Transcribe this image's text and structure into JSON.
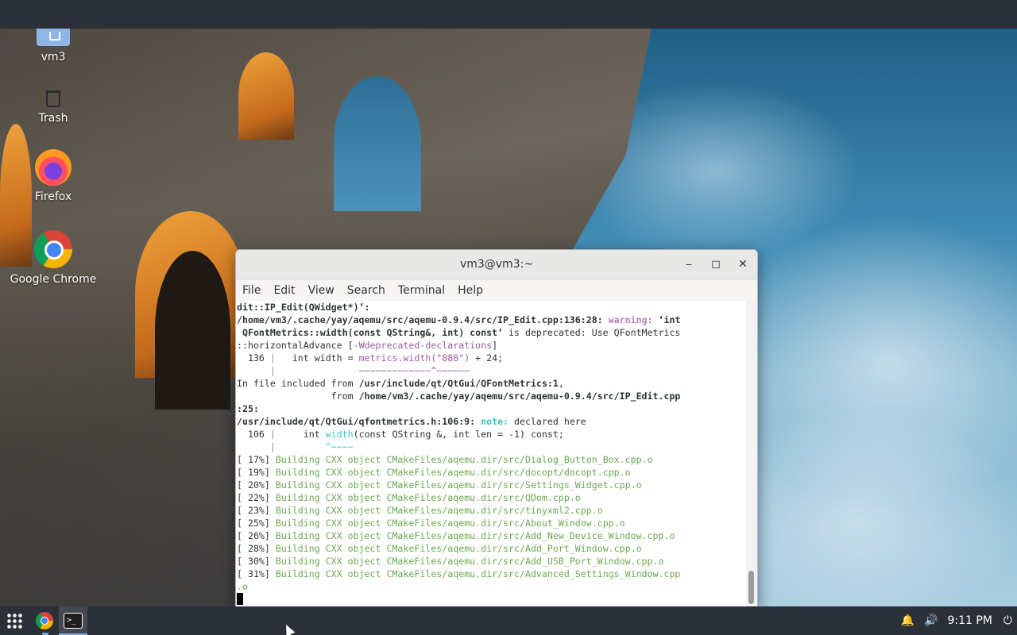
{
  "desktop": {
    "icons": [
      {
        "label": "vm3",
        "icon": "home-folder-icon"
      },
      {
        "label": "Trash",
        "icon": "trash-icon"
      },
      {
        "label": "Firefox",
        "icon": "firefox-icon"
      },
      {
        "label": "Google Chrome",
        "icon": "chrome-icon"
      }
    ]
  },
  "terminal": {
    "title": "vm3@vm3:~",
    "window_controls": {
      "minimize": "⎯",
      "maximize": "◻",
      "close": "✕"
    },
    "menu": [
      "File",
      "Edit",
      "View",
      "Search",
      "Terminal",
      "Help"
    ],
    "lines": {
      "l1": "dit::IP_Edit(QWidget*)’:",
      "l2a": "/home/vm3/.cache/yay/aqemu/src/aqemu-0.9.4/src/IP_Edit.cpp:136:28: ",
      "l2b": "warning: ",
      "l2c": "‘int",
      "l3a": " QFontMetrics::width(const QString&, int) const’",
      "l3b": " is deprecated: Use QFontMetrics",
      "l4a": "::horizontalAdvance [",
      "l4b": "-Wdeprecated-declarations",
      "l4c": "]",
      "l5a": "  136 ",
      "l5b": "|",
      "l5c": "   int width = ",
      "l5d": "metrics.width(\"888\")",
      "l5e": " + 24;",
      "l6a": "      ",
      "l6b": "|",
      "l6c": "               ",
      "l6d": "~~~~~~~~~~~~~^~~~~~~",
      "l7a": "In file included from ",
      "l7b": "/usr/include/qt/QtGui/QFontMetrics:1",
      "l7c": ",",
      "l8a": "                 from ",
      "l8b": "/home/vm3/.cache/yay/aqemu/src/aqemu-0.9.4/src/IP_Edit.cpp",
      "l9": ":25:",
      "l10a": "/usr/include/qt/QtGui/qfontmetrics.h:106:9: ",
      "l10b": "note: ",
      "l10c": "declared here",
      "l11a": "  106 ",
      "l11b": "|",
      "l11c": "     int ",
      "l11d": "width",
      "l11e": "(const QString &, int len = -1) const;",
      "l12a": "      ",
      "l12b": "|",
      "l12c": "         ",
      "l12d": "^~~~~",
      "build": [
        {
          "pct": "[ 17%] ",
          "msg": "Building CXX object CMakeFiles/aqemu.dir/src/Dialog_Button_Box.cpp.o"
        },
        {
          "pct": "[ 19%] ",
          "msg": "Building CXX object CMakeFiles/aqemu.dir/src/docopt/docopt.cpp.o"
        },
        {
          "pct": "[ 20%] ",
          "msg": "Building CXX object CMakeFiles/aqemu.dir/src/Settings_Widget.cpp.o"
        },
        {
          "pct": "[ 22%] ",
          "msg": "Building CXX object CMakeFiles/aqemu.dir/src/QDom.cpp.o"
        },
        {
          "pct": "[ 23%] ",
          "msg": "Building CXX object CMakeFiles/aqemu.dir/src/tinyxml2.cpp.o"
        },
        {
          "pct": "[ 25%] ",
          "msg": "Building CXX object CMakeFiles/aqemu.dir/src/About_Window.cpp.o"
        },
        {
          "pct": "[ 26%] ",
          "msg": "Building CXX object CMakeFiles/aqemu.dir/src/Add_New_Device_Window.cpp.o"
        },
        {
          "pct": "[ 28%] ",
          "msg": "Building CXX object CMakeFiles/aqemu.dir/src/Add_Port_Window.cpp.o"
        },
        {
          "pct": "[ 30%] ",
          "msg": "Building CXX object CMakeFiles/aqemu.dir/src/Add_USB_Port_Window.cpp.o"
        },
        {
          "pct": "[ 31%] ",
          "msg": "Building CXX object CMakeFiles/aqemu.dir/src/Advanced_Settings_Window.cpp"
        }
      ],
      "wrap_tail": ".o"
    }
  },
  "taskbar": {
    "apps_icon": "app-grid-icon",
    "pinned": [
      "chrome-icon",
      "terminal-icon"
    ],
    "terminal_glyph": ">_",
    "tray": {
      "bell": "🔔",
      "volume": "🔊",
      "clock": "9:11 PM",
      "power": "⏻"
    }
  },
  "colors": {
    "panel": "#2b3038",
    "warning": "#b57eb5",
    "note": "#34c6c6",
    "build_green": "#6aa84f"
  }
}
